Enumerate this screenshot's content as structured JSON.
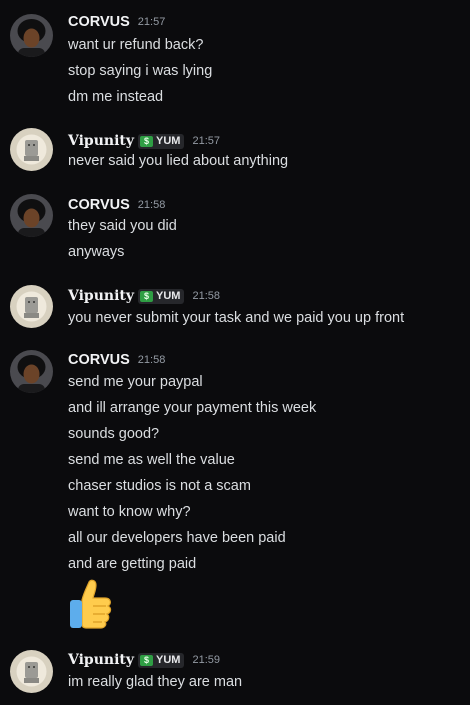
{
  "messages": [
    {
      "author": "CORVUS",
      "time": "21:57",
      "lines": [
        "want ur refund back?",
        "stop saying i was lying",
        "dm me instead"
      ]
    },
    {
      "author": "Vipunity",
      "tag": "YUM",
      "time": "21:57",
      "lines": [
        "never said you lied about anything"
      ]
    },
    {
      "author": "CORVUS",
      "time": "21:58",
      "lines": [
        "they said you did",
        "anyways"
      ]
    },
    {
      "author": "Vipunity",
      "tag": "YUM",
      "time": "21:58",
      "lines": [
        "you never submit your task and we paid you up front"
      ]
    },
    {
      "author": "CORVUS",
      "time": "21:58",
      "lines": [
        "send me your paypal",
        "and ill arrange your payment this week",
        "sounds good?",
        "send me as well the value",
        "chaser studios is not a scam",
        "want to know why?",
        "all our developers have been paid",
        "and are getting paid"
      ],
      "emoji": "thumbs-up"
    },
    {
      "author": "Vipunity",
      "tag": "YUM",
      "time": "21:59",
      "lines": [
        "im really glad they are man"
      ]
    }
  ],
  "tag_icon": "$",
  "colors": {
    "background": "#0b0b0d",
    "username": "#f2f3f5",
    "text": "#dbdee1",
    "timestamp": "#949ba4",
    "tag_icon": "#2f9e44"
  }
}
